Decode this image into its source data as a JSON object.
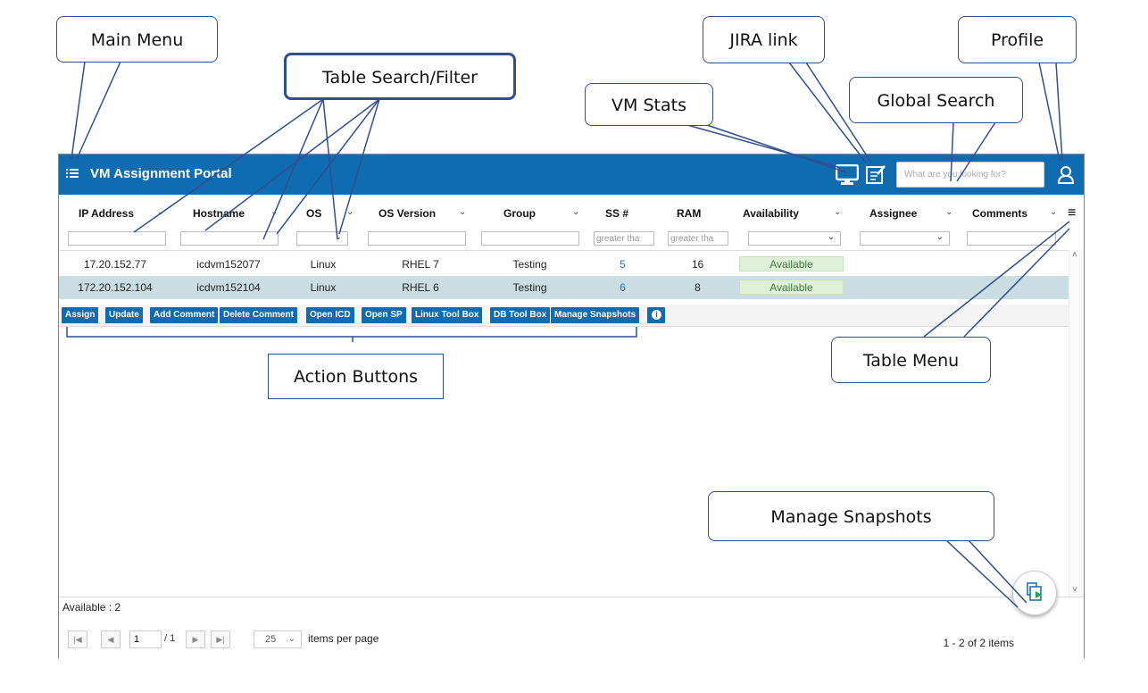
{
  "app": {
    "title": "VM Assignment Portal"
  },
  "header": {
    "search_placeholder": "What are you looking for?"
  },
  "table": {
    "columns": [
      {
        "label": "IP Address",
        "filter": "text",
        "placeholder": ""
      },
      {
        "label": "Hostname",
        "filter": "text",
        "placeholder": ""
      },
      {
        "label": "OS",
        "filter": "select",
        "placeholder": ""
      },
      {
        "label": "OS Version",
        "filter": "text",
        "placeholder": ""
      },
      {
        "label": "Group",
        "filter": "text",
        "placeholder": ""
      },
      {
        "label": "SS #",
        "filter": "text",
        "placeholder": "greater tha"
      },
      {
        "label": "RAM",
        "filter": "text",
        "placeholder": "greater tha"
      },
      {
        "label": "Availability",
        "filter": "select",
        "placeholder": ""
      },
      {
        "label": "Assignee",
        "filter": "select",
        "placeholder": ""
      },
      {
        "label": "Comments",
        "filter": "text",
        "placeholder": ""
      }
    ],
    "rows": [
      {
        "ip": "17.20.152.77",
        "hostname": "icdvm152077",
        "os": "Linux",
        "os_version": "RHEL 7",
        "group": "Testing",
        "ss": "5",
        "ram": "16",
        "availability": "Available",
        "selected": false
      },
      {
        "ip": "172.20.152.104",
        "hostname": "icdvm152104",
        "os": "Linux",
        "os_version": "RHEL 6",
        "group": "Testing",
        "ss": "6",
        "ram": "8",
        "availability": "Available",
        "selected": true
      }
    ]
  },
  "actions": [
    "Assign",
    "Update",
    "Add Comment",
    "Delete Comment",
    "Open ICD",
    "Open SP",
    "Linux Tool Box",
    "DB Tool Box",
    "Manage Snapshots"
  ],
  "footer": {
    "available": "Available : 2",
    "page": "1",
    "page_total": "/ 1",
    "page_size": "25",
    "per_page_label": "items per page",
    "summary": "1 - 2 of 2 items"
  },
  "callouts": {
    "main_menu": "Main Menu",
    "table_search": "Table Search/Filter",
    "vm_stats": "VM Stats",
    "jira_link": "JIRA link",
    "global_search": "Global Search",
    "profile": "Profile",
    "action_buttons": "Action Buttons",
    "table_menu": "Table Menu",
    "manage_snapshots": "Manage Snapshots"
  },
  "colors": {
    "brand": "#0f6cb0",
    "available_bg": "#dff0d8",
    "selected_row": "#c9dde2",
    "callout_border": "#2f4f8f"
  }
}
